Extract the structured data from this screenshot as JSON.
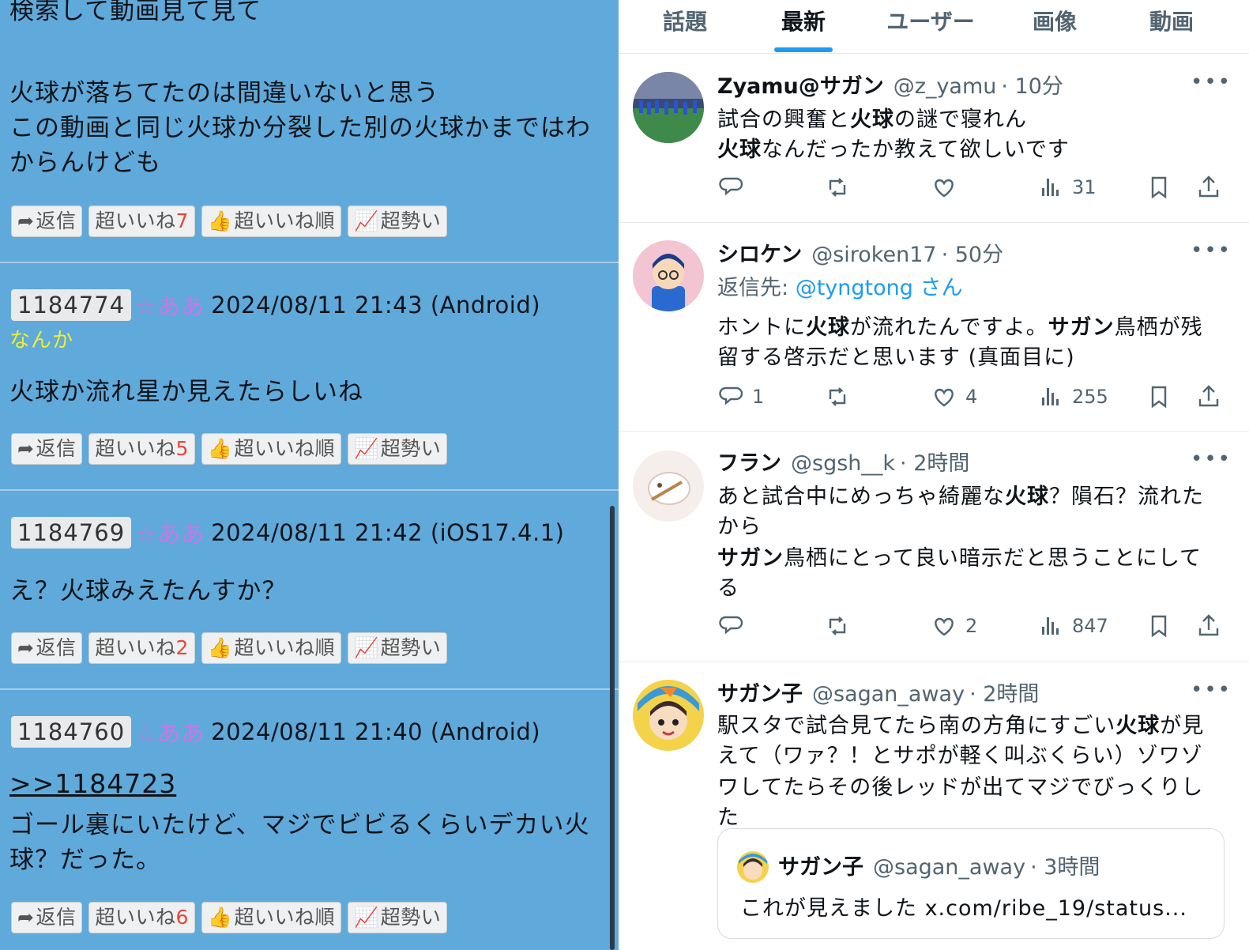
{
  "board": {
    "top_fragment": "検索して動画見て見て",
    "posts": [
      {
        "body": [
          "火球が落ちてたのは間違いないと思う",
          "この動画と同じ火球か分裂した別の火球かまではわ",
          "からんけども"
        ],
        "buttons": {
          "reply": "返信",
          "super_like": "超いいね",
          "super_like_count": "7",
          "super_like_order": "超いいね順",
          "trending": "超勢い"
        }
      },
      {
        "id": "1184774",
        "name": "☆ああ",
        "date": "2024/08/11 21:43 (Android)",
        "tag": "なんか",
        "body": [
          "火球か流れ星か見えたらしいね"
        ],
        "buttons": {
          "reply": "返信",
          "super_like": "超いいね",
          "super_like_count": "5",
          "super_like_order": "超いいね順",
          "trending": "超勢い"
        }
      },
      {
        "id": "1184769",
        "name": "☆ああ",
        "date": "2024/08/11 21:42 (iOS17.4.1)",
        "body": [
          "え？火球みえたんすか？"
        ],
        "buttons": {
          "reply": "返信",
          "super_like": "超いいね",
          "super_like_count": "2",
          "super_like_order": "超いいね順",
          "trending": "超勢い"
        }
      },
      {
        "id": "1184760",
        "name": "☆ああ",
        "date": "2024/08/11 21:40 (Android)",
        "anchor": ">>1184723",
        "body": [
          "ゴール裏にいたけど、マジでビビるくらいデカい火",
          "球？だった。"
        ],
        "buttons": {
          "reply": "返信",
          "super_like": "超いいね",
          "super_like_count": "6",
          "super_like_order": "超いいね順",
          "trending": "超勢い"
        }
      }
    ]
  },
  "twitter": {
    "tabs": [
      "話題",
      "最新",
      "ユーザー",
      "画像",
      "動画"
    ],
    "active_tab": "最新",
    "tweets": [
      {
        "name": "Zyamu@サガン",
        "handle": "@z_yamu",
        "time": "· 10分",
        "lines": [
          [
            {
              "t": "試合の興奮と"
            },
            {
              "t": "火球",
              "b": true
            },
            {
              "t": "の謎で寝れん"
            }
          ],
          [
            {
              "t": "火球",
              "b": true
            },
            {
              "t": "なんだったか教えて欲しいです"
            }
          ]
        ],
        "reply_count": "",
        "retweet_count": "",
        "like_count": "",
        "views": "31"
      },
      {
        "name": "シロケン",
        "handle": "@siroken17",
        "time": "· 50分",
        "reply_to_label": "返信先:",
        "reply_to": "@tyngtong さん",
        "lines": [
          [
            {
              "t": "ホントに"
            },
            {
              "t": "火球",
              "b": true
            },
            {
              "t": "が流れたんですよ。"
            },
            {
              "t": "サガン",
              "b": true
            },
            {
              "t": "鳥栖が残"
            }
          ],
          [
            {
              "t": "留する啓示だと思います (真面目に)"
            }
          ]
        ],
        "reply_count": "1",
        "retweet_count": "",
        "like_count": "4",
        "views": "255"
      },
      {
        "name": "フラン",
        "handle": "@sgsh__k",
        "time": "· 2時間",
        "lines": [
          [
            {
              "t": "あと試合中にめっちゃ綺麗な"
            },
            {
              "t": "火球",
              "b": true
            },
            {
              "t": "？隕石？流れた"
            }
          ],
          [
            {
              "t": "から"
            }
          ],
          [
            {
              "t": "サガン",
              "b": true
            },
            {
              "t": "鳥栖にとって良い暗示だと思うことにして"
            }
          ],
          [
            {
              "t": "る"
            }
          ]
        ],
        "reply_count": "",
        "retweet_count": "",
        "like_count": "2",
        "views": "847"
      },
      {
        "name": "サガン子",
        "handle": "@sagan_away",
        "time": "· 2時間",
        "lines": [
          [
            {
              "t": "駅スタで試合見てたら南の方角にすごい"
            },
            {
              "t": "火球",
              "b": true
            },
            {
              "t": "が見"
            }
          ],
          [
            {
              "t": "えて（ワァ？！とサポが軽く叫ぶくらい）ゾワゾ"
            }
          ],
          [
            {
              "t": "ワしてたらその後レッドが出てマジでびっくりし"
            }
          ],
          [
            {
              "t": "た"
            }
          ]
        ],
        "quote": {
          "name": "サガン子",
          "handle": "@sagan_away",
          "time": "· 3時間",
          "text": "これが見えました x.com/ribe_19/status..."
        }
      }
    ]
  },
  "colors": {
    "board_bg": "#60a9db",
    "accent": "#1d9bf0",
    "name_pink": "#c878e8",
    "count_red": "#e8463a",
    "tag_yellow": "#f0f02a"
  }
}
